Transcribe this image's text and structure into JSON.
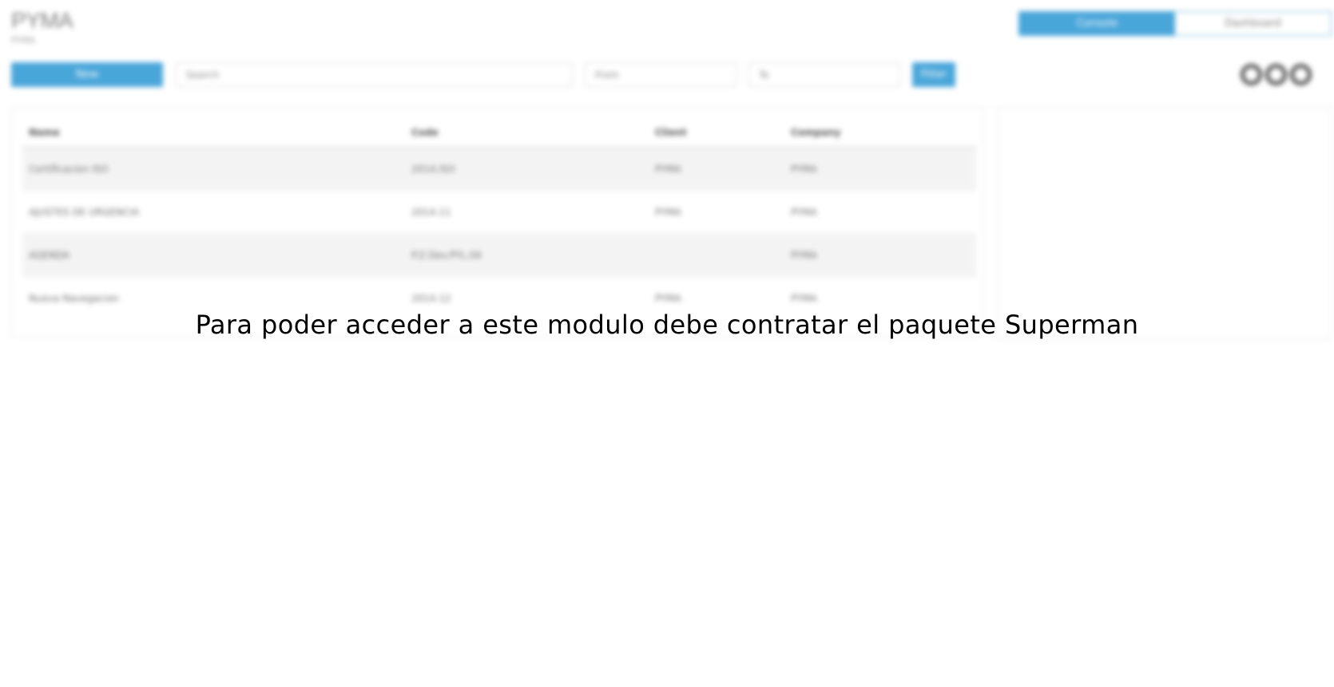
{
  "header": {
    "title": "PYMA",
    "subtitle": "PYMA"
  },
  "view_switch": {
    "active_label": "Console",
    "other_label": "Dashboard"
  },
  "toolbar": {
    "new_label": "New",
    "search_placeholder": "Search",
    "from_placeholder": "From",
    "to_placeholder": "To",
    "filter_label": "Filter"
  },
  "table": {
    "columns": [
      "Name",
      "Code",
      "Client",
      "Company"
    ],
    "rows": [
      {
        "name": "Certificacion ISO",
        "code": "2014.ISO",
        "client": "PYMA",
        "company": "PYMA"
      },
      {
        "name": "AJUSTES DE URGENCIA",
        "code": "2014.11",
        "client": "PYMA",
        "company": "PYMA"
      },
      {
        "name": "AGENDA",
        "code": "P.Z.Dev.PYL.04",
        "client": "",
        "company": "PYMA"
      },
      {
        "name": "Nueva Navegacion",
        "code": "2014.12",
        "client": "PYMA",
        "company": "PYMA"
      }
    ]
  },
  "overlay": {
    "message": "Para poder acceder a este modulo debe contratar el paquete Superman"
  },
  "colors": {
    "accent": "#2a97d3",
    "overlay_text": "#000000"
  },
  "icons": {
    "more_menu": "three-rings-icon"
  }
}
